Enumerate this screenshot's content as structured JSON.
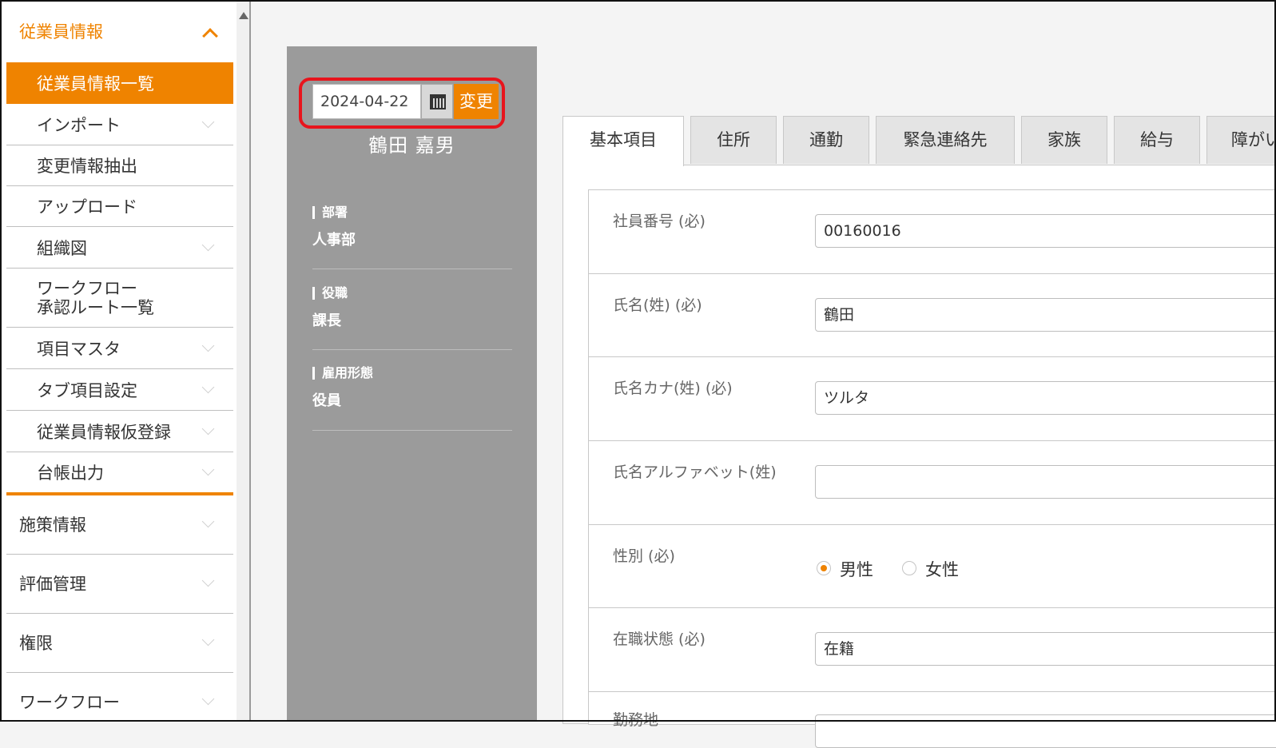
{
  "sidebar": {
    "section_open": "従業員情報",
    "items": [
      {
        "label": "従業員情報一覧"
      },
      {
        "label": "インポート"
      },
      {
        "label": "変更情報抽出"
      },
      {
        "label": "アップロード"
      },
      {
        "label": "組織図"
      },
      {
        "label": "ワークフロー\n承認ルート一覧"
      },
      {
        "label": "項目マスタ"
      },
      {
        "label": "タブ項目設定"
      },
      {
        "label": "従業員情報仮登録"
      },
      {
        "label": "台帳出力"
      }
    ],
    "sections": [
      {
        "label": "施策情報"
      },
      {
        "label": "評価管理"
      },
      {
        "label": "権限"
      },
      {
        "label": "ワークフロー"
      }
    ]
  },
  "profile": {
    "date": "2024-04-22",
    "change_button": "変更",
    "name": "鶴田 嘉男",
    "department_label": "部署",
    "department": "人事部",
    "position_label": "役職",
    "position": "課長",
    "employment_label": "雇用形態",
    "employment": "役員"
  },
  "tabs": [
    {
      "label": "基本項目"
    },
    {
      "label": "住所"
    },
    {
      "label": "通勤"
    },
    {
      "label": "緊急連絡先"
    },
    {
      "label": "家族"
    },
    {
      "label": "給与"
    },
    {
      "label": "障がい"
    }
  ],
  "form": {
    "employee_no_label": "社員番号 (必)",
    "employee_no": "00160016",
    "last_name_label": "氏名(姓) (必)",
    "last_name": "鶴田",
    "last_name_kana_label": "氏名カナ(姓) (必)",
    "last_name_kana": "ツルタ",
    "last_name_alpha_label": "氏名アルファベット(姓)",
    "last_name_alpha": "",
    "gender_label": "性別 (必)",
    "gender_male": "男性",
    "gender_female": "女性",
    "status_label": "在職状態 (必)",
    "status": "在籍",
    "next_label": "勤務地"
  },
  "colors": {
    "accent": "#ef8300",
    "highlight": "#e8141c",
    "panel": "#9b9b9b"
  }
}
